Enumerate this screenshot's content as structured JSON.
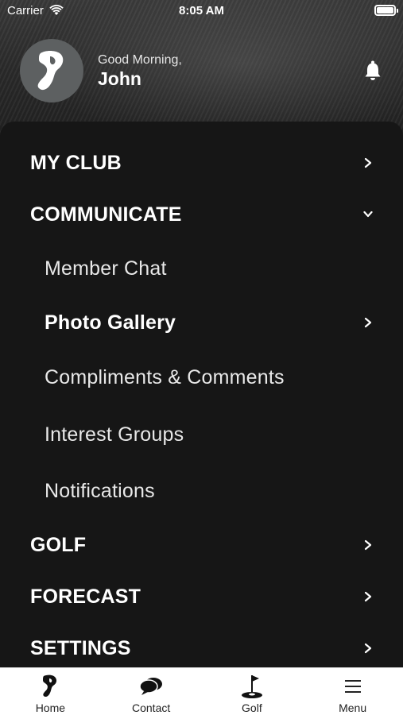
{
  "status_bar": {
    "carrier": "Carrier",
    "time": "8:05 AM"
  },
  "header": {
    "greeting": "Good Morning,",
    "name": "John"
  },
  "menu": [
    {
      "label": "MY CLUB",
      "icon": "chevron-right-icon"
    },
    {
      "label": "COMMUNICATE",
      "icon": "chevron-down-icon"
    },
    {
      "label": "Member Chat"
    },
    {
      "label": "Photo Gallery",
      "icon": "chevron-right-icon"
    },
    {
      "label": "Compliments & Comments"
    },
    {
      "label": "Interest Groups"
    },
    {
      "label": "Notifications"
    },
    {
      "label": "GOLF",
      "icon": "chevron-right-icon"
    },
    {
      "label": "FORECAST",
      "icon": "chevron-right-icon"
    },
    {
      "label": "SETTINGS",
      "icon": "chevron-right-icon"
    }
  ],
  "tabs": [
    {
      "label": "Home",
      "icon": "club-logo-icon"
    },
    {
      "label": "Contact",
      "icon": "chat-bubbles-icon"
    },
    {
      "label": "Golf",
      "icon": "golf-flag-icon"
    },
    {
      "label": "Menu",
      "icon": "hamburger-icon"
    }
  ],
  "colors": {
    "drawer_bg": "#161616",
    "tabbar_bg": "#ffffff",
    "text": "#ffffff",
    "avatar_bg": "#5d6061"
  }
}
